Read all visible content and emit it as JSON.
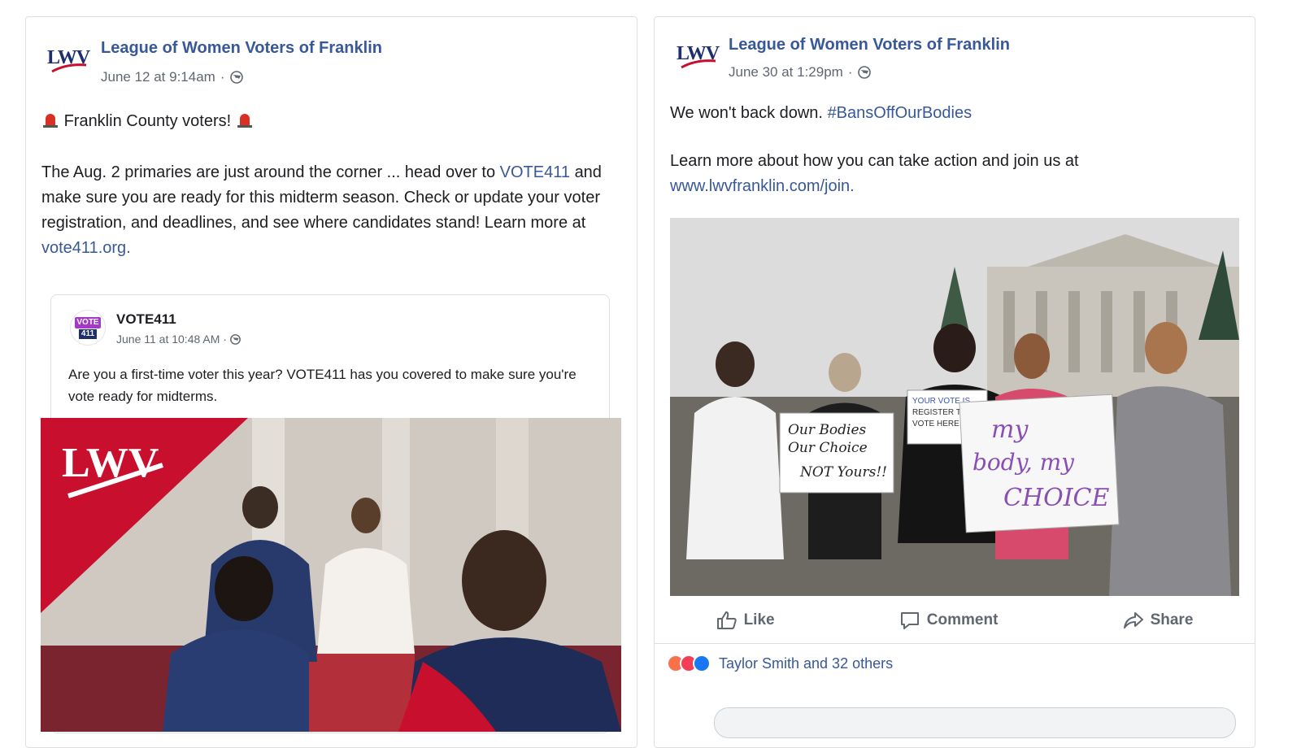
{
  "posts": [
    {
      "page_name": "League of Women Voters of Franklin",
      "logo_text": "LWV",
      "time": "June 12 at 9:14am",
      "text": {
        "line1": "Franklin County voters!",
        "p2_before": "The Aug. 2 primaries are just around the corner ... head over to",
        "p2_link": "VOTE411",
        "p2_after": "and make sure you are ready for this midterm season. Check or update your voter registration, and deadlines, and see where candidates stand! Learn more at",
        "p2_link2": "vote411.org."
      },
      "shared": {
        "logo_top": "VOTE",
        "logo_bottom": "411",
        "name": "VOTE411",
        "time": "June 11 at 10:48 AM",
        "text": "Are you a first-time voter this year? VOTE411 has you covered to make sure you're vote ready for midterms."
      },
      "image": {
        "logo": "LWV",
        "description_icon": "photo-voter-registration-table"
      }
    },
    {
      "page_name": "League of Women Voters of Franklin",
      "logo_text": "LWV",
      "time": "June 30 at 1:29pm",
      "text": {
        "line1_before": "We won't back down.",
        "hashtag": "#BansOffOurBodies",
        "line2": "Learn more about how you can take action and join us at",
        "link": "www.lwvfranklin.com/join."
      },
      "image": {
        "sign1_l1": "Our Bodies",
        "sign1_l2": "Our Choice",
        "sign1_l3": "NOT Yours!!",
        "sign2_l1": "YOUR VOTE IS",
        "sign2_l2": "REGISTER TO",
        "sign2_l3": "VOTE HERE",
        "sign3_l1": "my",
        "sign3_l2": "body, my",
        "sign3_l3": "CHOICE"
      },
      "actions": {
        "like": "Like",
        "comment": "Comment",
        "share": "Share"
      },
      "reactions": {
        "text": "Taylor Smith and 32 others"
      }
    }
  ],
  "colors": {
    "link": "#385898",
    "lwv_red": "#c8102e",
    "lwv_navy": "#1d2f6f",
    "vote411_purple": "#a23ac6"
  }
}
